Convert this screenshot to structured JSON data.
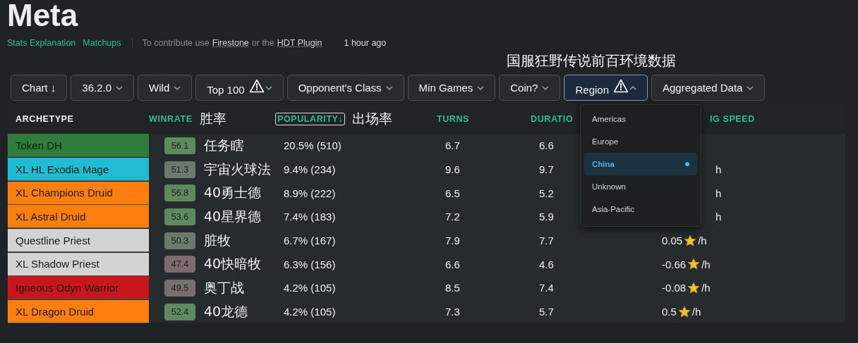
{
  "title": "Meta",
  "links": [
    {
      "label": "Stats Explanation"
    },
    {
      "label": "Matchups"
    }
  ],
  "contribute": {
    "prefix": "To contribute use",
    "link1": "Firestone",
    "middle": "or the",
    "link2": "HDT Plugin"
  },
  "updated": "1 hour ago",
  "annotation": "国服狂野传说前百环境数据",
  "filters": [
    {
      "label": "Chart ↓",
      "caret": false,
      "warning": false,
      "open": false
    },
    {
      "label": "36.2.0",
      "caret": true,
      "warning": false,
      "open": false
    },
    {
      "label": "Wild",
      "caret": true,
      "warning": false,
      "open": false
    },
    {
      "label": "Top 100",
      "caret": true,
      "warning": true,
      "open": false
    },
    {
      "label": "Opponent's Class",
      "caret": true,
      "warning": false,
      "open": false
    },
    {
      "label": "Min Games",
      "caret": true,
      "warning": false,
      "open": false
    },
    {
      "label": "Coin?",
      "caret": true,
      "warning": false,
      "open": false
    },
    {
      "label": "Region",
      "caret": true,
      "warning": true,
      "open": true
    },
    {
      "label": "Aggregated Data",
      "caret": true,
      "warning": false,
      "open": false
    }
  ],
  "columns": [
    {
      "label": "ARCHETYPE",
      "kind": "archetype",
      "sorted": false
    },
    {
      "label": "WINRATE",
      "kind": "winrate",
      "sorted": false,
      "note": "胜率"
    },
    {
      "label": "POPULARITY↓",
      "kind": "popularity",
      "sorted": true,
      "note": "出场率"
    },
    {
      "label": "TURNS",
      "kind": "turns",
      "sorted": false
    },
    {
      "label": "DURATIO",
      "kind": "duration",
      "sorted": false
    },
    {
      "label": "IG SPEED",
      "kind": "climb",
      "sorted": false
    }
  ],
  "rows": [
    {
      "archetype": "Token DH",
      "color": "#2e7d3a",
      "winrate": "56.1",
      "note": "任务瞎",
      "popularity": "20.5% (510)",
      "turns": "6.7",
      "duration": "6.6"
    },
    {
      "archetype": "XL HL Exodia Mage",
      "color": "#1fbcd2",
      "winrate": "51.3",
      "note": "宇宙火球法",
      "popularity": "9.4% (234)",
      "turns": "9.6",
      "duration": "9.7",
      "climb": {
        "unit": "h"
      }
    },
    {
      "archetype": "XL Champions Druid",
      "color": "#ff7f0e",
      "winrate": "56.8",
      "note": "40勇士德",
      "popularity": "8.9% (222)",
      "turns": "6.5",
      "duration": "5.2",
      "climb": {
        "unit": "h"
      }
    },
    {
      "archetype": "XL Astral Druid",
      "color": "#ff7f0e",
      "winrate": "53.6",
      "note": "40星界德",
      "popularity": "7.4% (183)",
      "turns": "7.2",
      "duration": "5.9",
      "climb": {
        "unit": "h"
      }
    },
    {
      "archetype": "Questline Priest",
      "color": "#d3d3d3",
      "winrate": "50.3",
      "note": "脏牧",
      "popularity": "6.7% (167)",
      "turns": "7.9",
      "duration": "7.7",
      "climb": {
        "value": "0.05",
        "unit": "/h"
      }
    },
    {
      "archetype": "XL Shadow Priest",
      "color": "#d3d3d3",
      "winrate": "47.4",
      "note": "40快暗牧",
      "popularity": "6.3% (156)",
      "turns": "6.6",
      "duration": "4.6",
      "climb": {
        "value": "-0.66",
        "unit": "/h"
      }
    },
    {
      "archetype": "Igneous Odyn Warrior",
      "color": "#c8161d",
      "winrate": "49.5",
      "note": "奥丁战",
      "popularity": "4.2% (105)",
      "turns": "8.5",
      "duration": "7.4",
      "climb": {
        "value": "-0.08",
        "unit": "/h"
      }
    },
    {
      "archetype": "XL Dragon Druid",
      "color": "#ff7f0e",
      "winrate": "52.4",
      "note": "40龙德",
      "popularity": "4.2% (105)",
      "turns": "7.3",
      "duration": "5.7",
      "climb": {
        "value": "0.5",
        "unit": "/h"
      }
    }
  ],
  "region_menu": [
    {
      "label": "Americas",
      "selected": false
    },
    {
      "label": "Europe",
      "selected": false
    },
    {
      "label": "China",
      "selected": true
    },
    {
      "label": "Unknown",
      "selected": false
    },
    {
      "label": "Asia-Pacific",
      "selected": false
    }
  ]
}
